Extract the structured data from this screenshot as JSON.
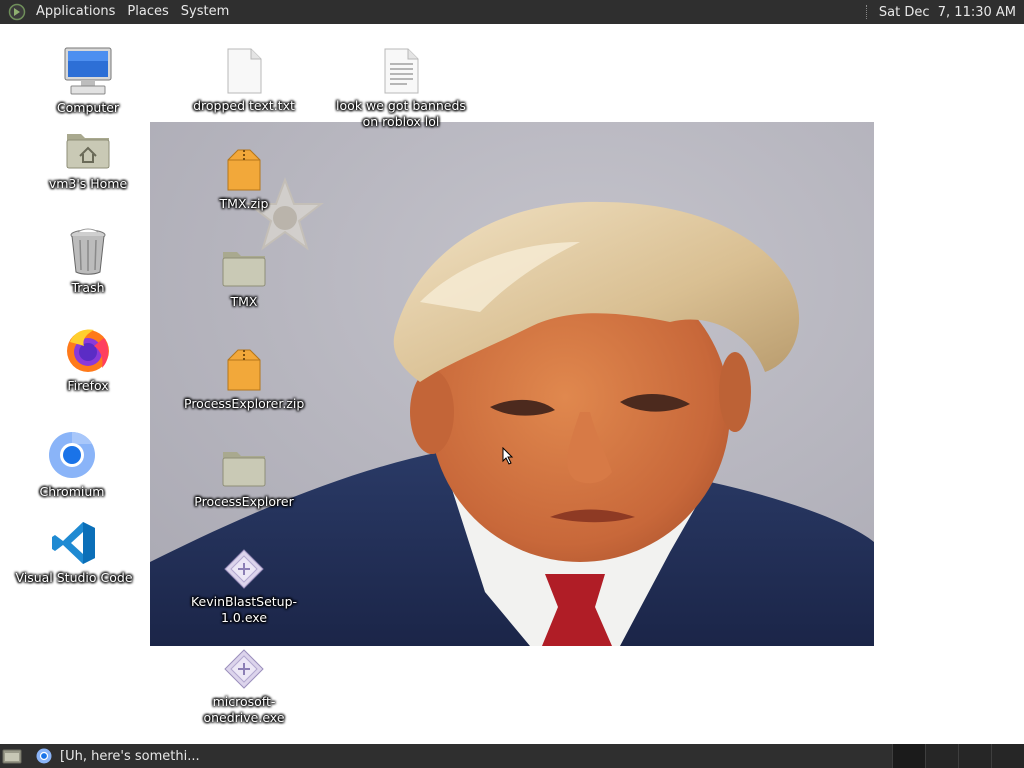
{
  "top_panel": {
    "menus": [
      "Applications",
      "Places",
      "System"
    ],
    "clock": "Sat Dec  7, 11:30 AM"
  },
  "desktop_icons": {
    "computer": "Computer",
    "home": "vm3's Home",
    "trash": "Trash",
    "firefox": "Firefox",
    "chromium": "Chromium",
    "vscode": "Visual Studio Code",
    "dropped_text": "dropped text.txt",
    "look_banned": "look we got banneds on roblox lol",
    "tmx_zip": "TMX.zip",
    "tmx": "TMX",
    "processexplorer_zip": "ProcessExplorer.zip",
    "processexplorer": "ProcessExplorer",
    "kevinblast": "KevinBlastSetup-1.0.exe",
    "onedrive": "microsoft-onedrive.exe"
  },
  "taskbar": {
    "task_title": "[Uh, here's somethi..."
  },
  "colors": {
    "panel_bg": "#2f2f2f",
    "desktop_bg": "#ffffff",
    "folder_gray": "#c9c9b9",
    "zip_orange": "#f0a830"
  }
}
